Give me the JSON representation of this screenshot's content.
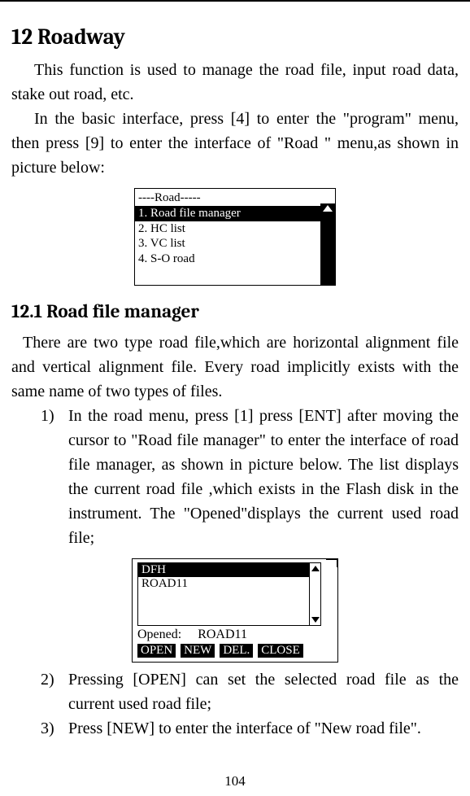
{
  "section": {
    "title": "12 Roadway",
    "intro": "This function is used to manage the road file, input road data, stake out road, etc.",
    "basic": "In the basic interface, press [4] to enter the \"program\" menu, then press [9] to enter the interface of \"Road \" menu,as shown in picture below:"
  },
  "menu": {
    "header": "----Road-----",
    "selected": "1. Road file manager",
    "items": [
      "2. HC list",
      "3. VC list",
      "4. S-O road"
    ]
  },
  "subsection": {
    "title": "12.1 Road file manager",
    "intro": "There are two type road file,which are horizontal alignment file and vertical alignment file. Every road implicitly exists with the same name of two types of files."
  },
  "steps": {
    "s1_num": "1)",
    "s1": "In the road menu, press [1] press [ENT] after moving the cursor to \"Road file manager\" to enter the interface of road file manager, as shown in picture below. The list displays the current road file ,which exists in the Flash disk in the instrument. The \"Opened\"displays the current used road file;",
    "s2_num": "2)",
    "s2": "Pressing [OPEN] can set the selected road file as the current used road file;",
    "s3_num": "3)",
    "s3": "Press [NEW] to enter the interface of \"New road file\"."
  },
  "filebox": {
    "selected": "DFH",
    "row2": "ROAD11",
    "opened_label": "Opened:",
    "opened_value": "ROAD11",
    "buttons": {
      "open": "OPEN",
      "new": "NEW",
      "del": "DEL.",
      "close": "CLOSE"
    }
  },
  "page_number": "104"
}
